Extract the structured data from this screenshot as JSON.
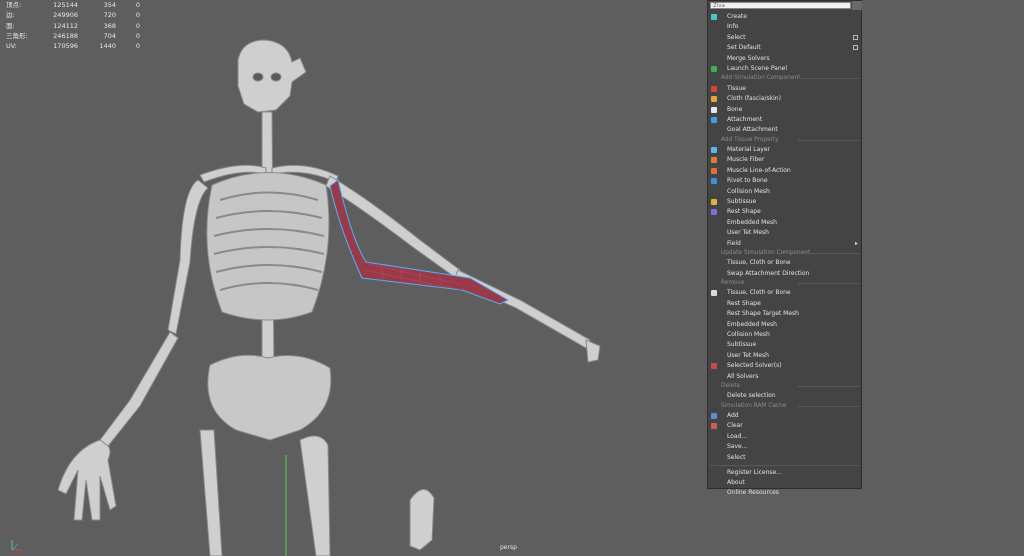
{
  "hud": {
    "rows": [
      {
        "label": "顶点:",
        "v1": "125144",
        "v2": "354",
        "v3": "0"
      },
      {
        "label": "边:",
        "v1": "249906",
        "v2": "720",
        "v3": "0"
      },
      {
        "label": "面:",
        "v1": "124112",
        "v2": "368",
        "v3": "0"
      },
      {
        "label": "三角形:",
        "v1": "246188",
        "v2": "704",
        "v3": "0"
      },
      {
        "label": "UV:",
        "v1": "170596",
        "v2": "1440",
        "v3": "0"
      }
    ]
  },
  "viewport": {
    "camera_label": "persp"
  },
  "menu": {
    "search_value": "Ziva",
    "items": [
      {
        "type": "item",
        "label": "Create",
        "icon": "ziva-logo-icon",
        "color": "#4cc3c9"
      },
      {
        "type": "item",
        "label": "Info"
      },
      {
        "type": "item",
        "label": "Select",
        "option_box": true
      },
      {
        "type": "item",
        "label": "Set Default",
        "option_box": true
      },
      {
        "type": "item",
        "label": "Merge Solvers"
      },
      {
        "type": "item",
        "label": "Launch Scene Panel",
        "icon": "scene-panel-icon",
        "color": "#3fae55"
      },
      {
        "type": "header",
        "label": "Add Simulation Component"
      },
      {
        "type": "item",
        "label": "Tissue",
        "icon": "tissue-icon",
        "color": "#d9453a"
      },
      {
        "type": "item",
        "label": "Cloth (fascia/skin)",
        "icon": "cloth-icon",
        "color": "#e8a23b"
      },
      {
        "type": "item",
        "label": "Bone",
        "icon": "bone-icon",
        "color": "#e6e6e6"
      },
      {
        "type": "item",
        "label": "Attachment",
        "icon": "attachment-icon",
        "color": "#3da0e0"
      },
      {
        "type": "item",
        "label": "Goal Attachment"
      },
      {
        "type": "header",
        "label": "Add Tissue Property"
      },
      {
        "type": "item",
        "label": "Material Layer",
        "icon": "material-layer-icon",
        "color": "#5bb7e8"
      },
      {
        "type": "item",
        "label": "Muscle Fiber",
        "icon": "muscle-fiber-icon",
        "color": "#e07a3a"
      },
      {
        "type": "item",
        "label": "Muscle Line-of-Action",
        "icon": "line-of-action-icon",
        "color": "#e0703a"
      },
      {
        "type": "item",
        "label": "Rivet to Bone",
        "icon": "rivet-icon",
        "color": "#3d8fe0"
      },
      {
        "type": "item",
        "label": "Collision Mesh"
      },
      {
        "type": "item",
        "label": "Subtissue",
        "icon": "subtissue-icon",
        "color": "#e0b43a"
      },
      {
        "type": "item",
        "label": "Rest Shape",
        "icon": "rest-shape-icon",
        "color": "#7b6fe0"
      },
      {
        "type": "item",
        "label": "Embedded Mesh"
      },
      {
        "type": "item",
        "label": "User Tet Mesh"
      },
      {
        "type": "item",
        "label": "Field",
        "submenu": true
      },
      {
        "type": "header",
        "label": "Update Simulation Component"
      },
      {
        "type": "item",
        "label": "Tissue, Cloth or Bone"
      },
      {
        "type": "item",
        "label": "Swap Attachment Direction"
      },
      {
        "type": "header",
        "label": "Remove"
      },
      {
        "type": "item",
        "label": "Tissue, Cloth or Bone",
        "icon": "remove-icon",
        "color": "#d9d9d9"
      },
      {
        "type": "item",
        "label": "Rest Shape"
      },
      {
        "type": "item",
        "label": "Rest Shape Target Mesh"
      },
      {
        "type": "item",
        "label": "Embedded Mesh"
      },
      {
        "type": "item",
        "label": "Collision Mesh"
      },
      {
        "type": "item",
        "label": "Subtissue"
      },
      {
        "type": "item",
        "label": "User Tet Mesh"
      },
      {
        "type": "item",
        "label": "Selected Solver(s)",
        "icon": "solver-remove-icon",
        "color": "#c94a4a"
      },
      {
        "type": "item",
        "label": "All Solvers"
      },
      {
        "type": "header",
        "label": "Delete"
      },
      {
        "type": "item",
        "label": "Delete selection"
      },
      {
        "type": "header",
        "label": "Simulation RAM Cache"
      },
      {
        "type": "item",
        "label": "Add",
        "icon": "cache-add-icon",
        "color": "#5b8fd0"
      },
      {
        "type": "item",
        "label": "Clear",
        "icon": "cache-clear-icon",
        "color": "#d05b5b"
      },
      {
        "type": "item",
        "label": "Load..."
      },
      {
        "type": "item",
        "label": "Save..."
      },
      {
        "type": "item",
        "label": "Select"
      },
      {
        "type": "sep"
      },
      {
        "type": "item",
        "label": "Register License..."
      },
      {
        "type": "item",
        "label": "About"
      },
      {
        "type": "item",
        "label": "Online Resources"
      }
    ]
  }
}
